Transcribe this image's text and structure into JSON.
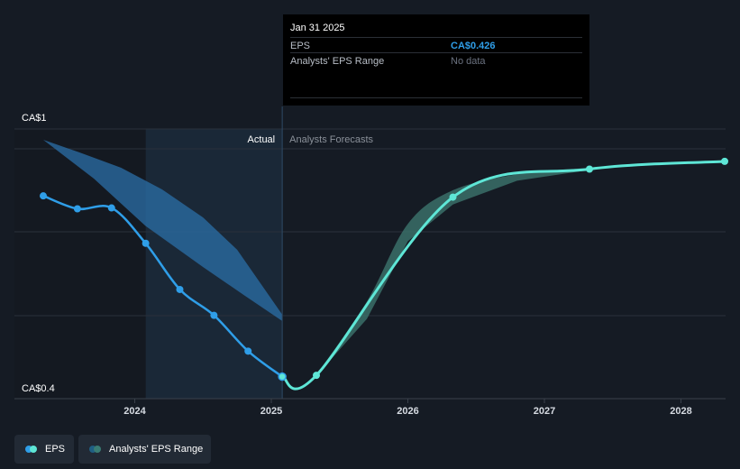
{
  "chart_data": {
    "type": "line",
    "y_axis": {
      "top_label": "CA$1",
      "bottom_label": "CA$0.4",
      "ylim": [
        0.4,
        1.0
      ]
    },
    "x_ticks": [
      "2024",
      "2025",
      "2026",
      "2027",
      "2028"
    ],
    "x_tick_values": [
      2024.0,
      2025.0,
      2026.0,
      2027.0,
      2028.0
    ],
    "xlim": [
      2023.15,
      2028.33
    ],
    "divider_x": 2025.08,
    "past_region_start": 2024.08,
    "region_labels": {
      "actual": "Actual",
      "forecast": "Analysts Forecasts"
    },
    "colors": {
      "eps_actual": "#2f9ee8",
      "eps_forecast": "#5ee6d6",
      "range_past": "#2b6fa8",
      "range_forecast": "#3a6f68"
    },
    "series": [
      {
        "name": "EPS",
        "actual": [
          [
            2023.33,
            0.845
          ],
          [
            2023.58,
            0.815
          ],
          [
            2023.83,
            0.817
          ],
          [
            2024.08,
            0.735
          ],
          [
            2024.33,
            0.628
          ],
          [
            2024.58,
            0.568
          ],
          [
            2024.83,
            0.485
          ],
          [
            2025.08,
            0.426
          ]
        ],
        "forecast": [
          [
            2025.08,
            0.426
          ],
          [
            2025.33,
            0.429
          ],
          [
            2026.33,
            0.842
          ],
          [
            2027.33,
            0.907
          ],
          [
            2028.33,
            0.925
          ]
        ]
      }
    ],
    "range_past_band": {
      "upper": [
        [
          2023.33,
          0.975
        ],
        [
          2023.6,
          0.945
        ],
        [
          2023.9,
          0.91
        ],
        [
          2024.2,
          0.86
        ],
        [
          2024.5,
          0.795
        ],
        [
          2024.75,
          0.72
        ],
        [
          2025.08,
          0.57
        ]
      ],
      "lower": [
        [
          2023.33,
          0.975
        ],
        [
          2023.7,
          0.885
        ],
        [
          2024.08,
          0.775
        ],
        [
          2024.5,
          0.68
        ],
        [
          2024.8,
          0.615
        ],
        [
          2025.08,
          0.555
        ]
      ]
    },
    "range_forecast_band": {
      "upper": [
        [
          2025.33,
          0.43
        ],
        [
          2025.7,
          0.6
        ],
        [
          2026.0,
          0.78
        ],
        [
          2026.33,
          0.858
        ],
        [
          2026.8,
          0.895
        ],
        [
          2027.33,
          0.91
        ]
      ],
      "lower": [
        [
          2025.33,
          0.428
        ],
        [
          2025.7,
          0.56
        ],
        [
          2026.0,
          0.74
        ],
        [
          2026.33,
          0.825
        ],
        [
          2026.8,
          0.88
        ],
        [
          2027.33,
          0.905
        ]
      ]
    }
  },
  "tooltip": {
    "date": "Jan 31 2025",
    "eps_label": "EPS",
    "eps_value": "CA$0.426",
    "range_label": "Analysts' EPS Range",
    "range_value": "No data"
  },
  "legend": {
    "eps": "EPS",
    "range": "Analysts' EPS Range"
  }
}
